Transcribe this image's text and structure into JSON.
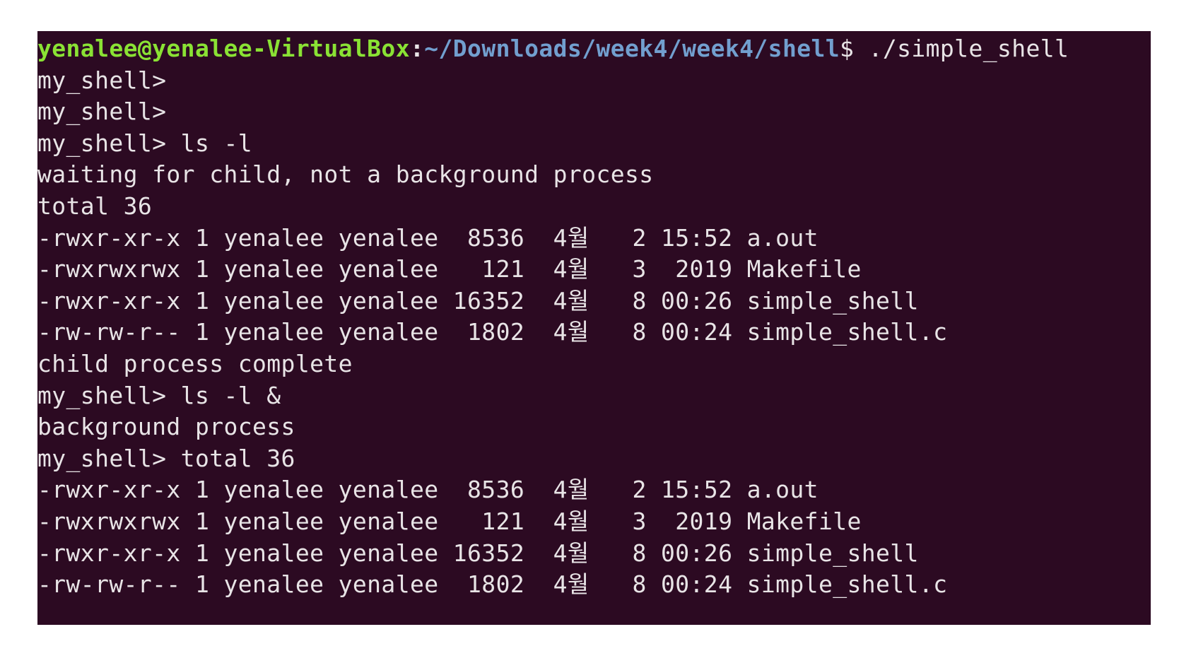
{
  "terminal": {
    "prompt_user_host": "yenalee@yenalee-VirtualBox",
    "prompt_colon": ":",
    "prompt_path": "~/Downloads/week4/week4/shell",
    "prompt_dollar": "$ ",
    "command": "./simple_shell",
    "colors": {
      "background": "#2c0a22",
      "text": "#e8e4e6",
      "user_host": "#8ae234",
      "path": "#729fcf"
    },
    "lines": [
      "my_shell>",
      "my_shell>",
      "my_shell> ls -l",
      "waiting for child, not a background process",
      "total 36",
      "-rwxr-xr-x 1 yenalee yenalee  8536  4월   2 15:52 a.out",
      "-rwxrwxrwx 1 yenalee yenalee   121  4월   3  2019 Makefile",
      "-rwxr-xr-x 1 yenalee yenalee 16352  4월   8 00:26 simple_shell",
      "-rw-rw-r-- 1 yenalee yenalee  1802  4월   8 00:24 simple_shell.c",
      "child process complete",
      "my_shell> ls -l &",
      "background process",
      "my_shell> total 36",
      "-rwxr-xr-x 1 yenalee yenalee  8536  4월   2 15:52 a.out",
      "-rwxrwxrwx 1 yenalee yenalee   121  4월   3  2019 Makefile",
      "-rwxr-xr-x 1 yenalee yenalee 16352  4월   8 00:26 simple_shell",
      "-rw-rw-r-- 1 yenalee yenalee  1802  4월   8 00:24 simple_shell.c"
    ]
  }
}
